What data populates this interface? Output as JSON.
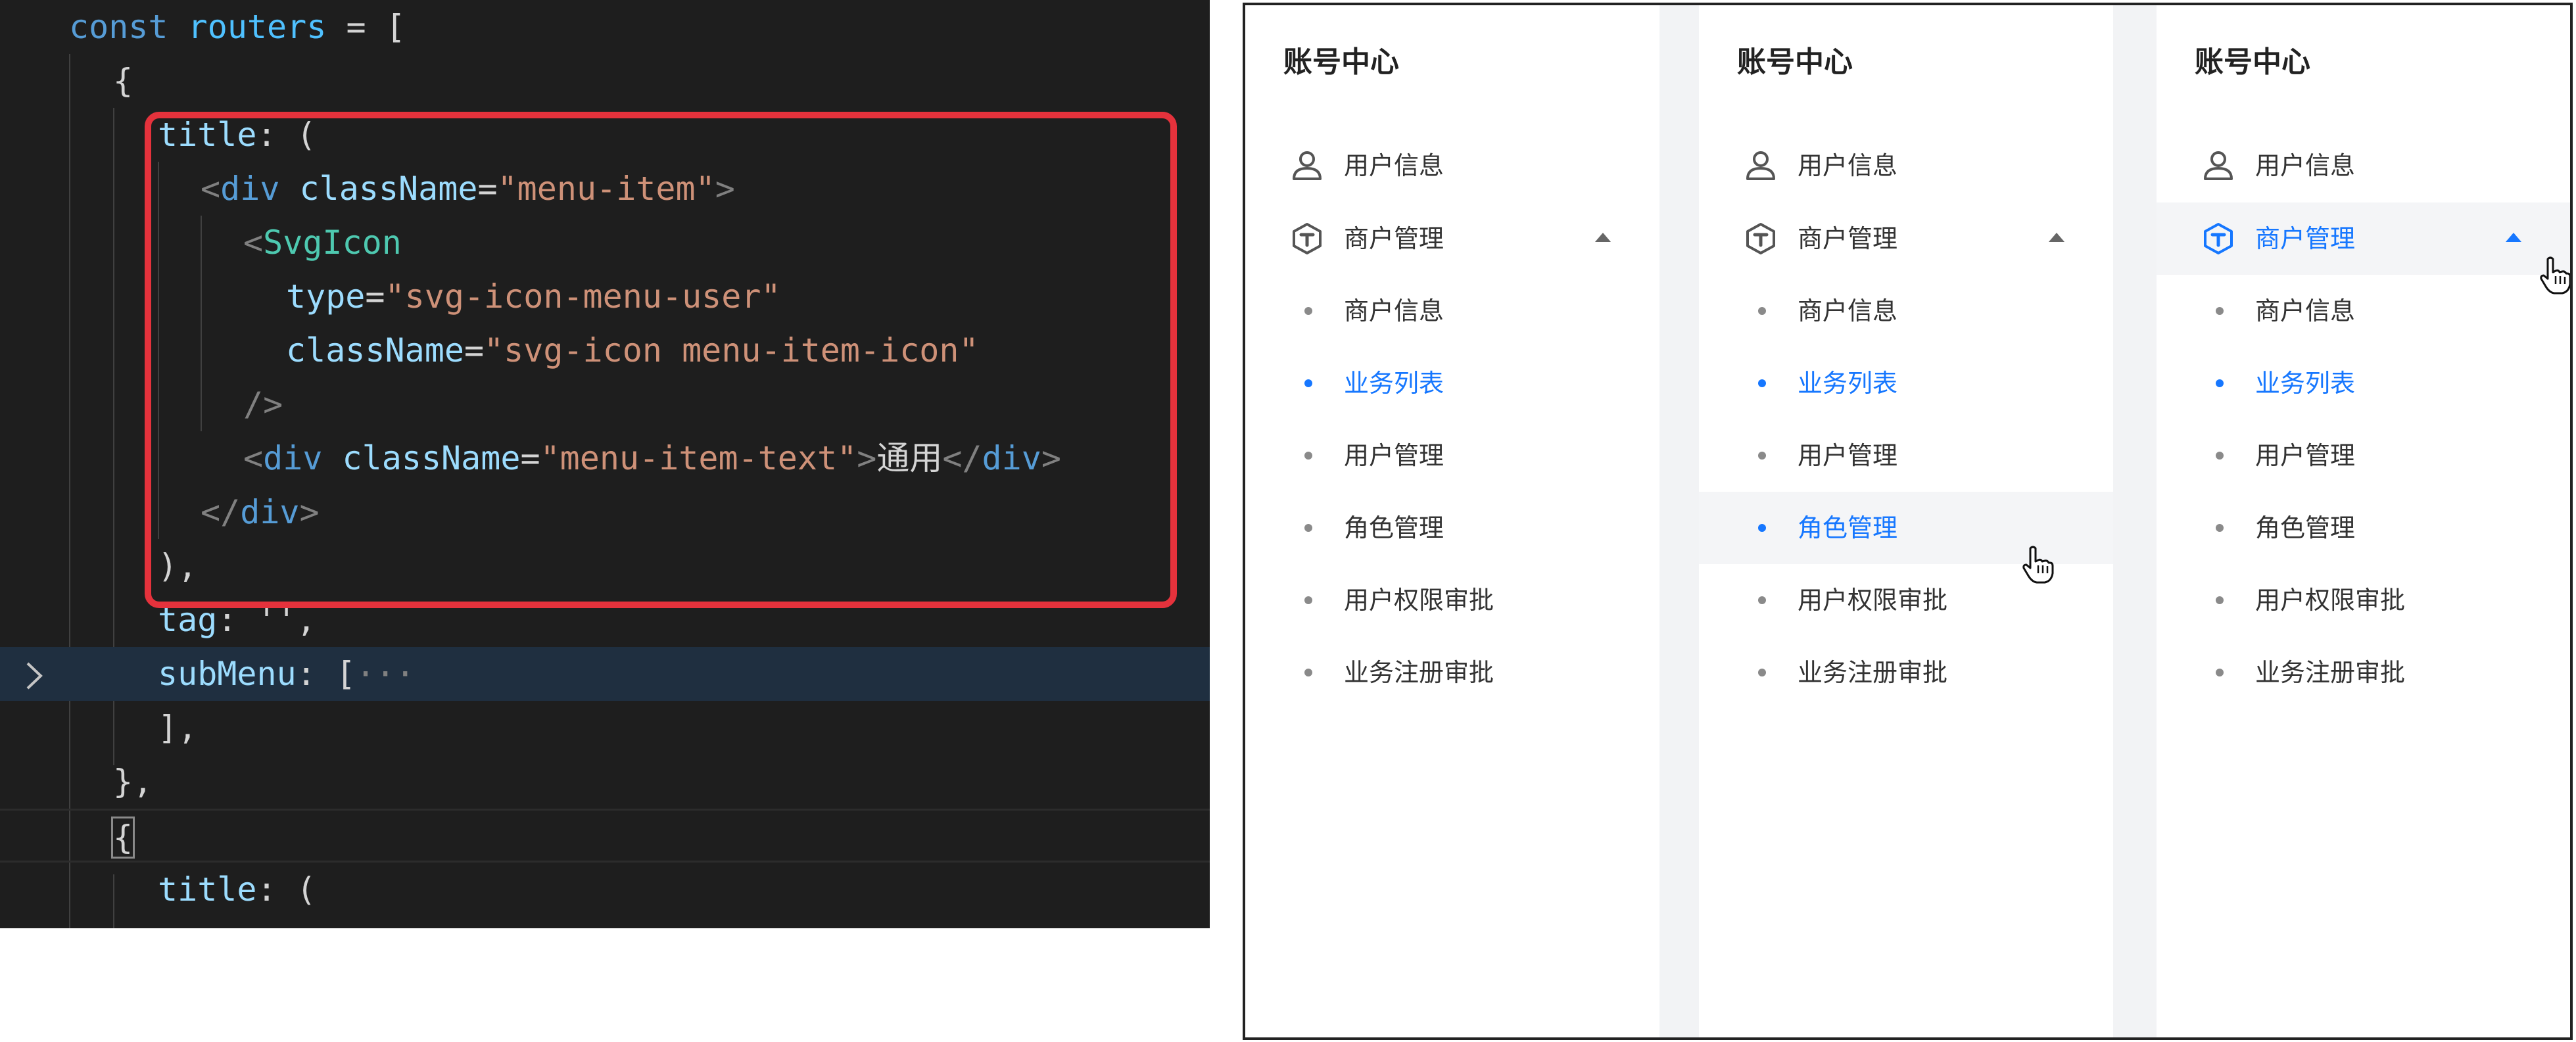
{
  "code": {
    "lines": [
      {
        "tokens": [
          {
            "t": "const ",
            "c": "kw"
          },
          {
            "t": "routers",
            "c": "var"
          },
          {
            "t": " = [",
            "c": "plain"
          }
        ]
      },
      {
        "tokens": [
          {
            "t": "{",
            "c": "plain"
          }
        ]
      },
      {
        "tokens": [
          {
            "t": "title",
            "c": "prop"
          },
          {
            "t": ": (",
            "c": "plain"
          }
        ]
      },
      {
        "tokens": [
          {
            "t": "<",
            "c": "punc"
          },
          {
            "t": "div",
            "c": "tag"
          },
          {
            "t": " ",
            "c": "plain"
          },
          {
            "t": "className",
            "c": "attr"
          },
          {
            "t": "=",
            "c": "plain"
          },
          {
            "t": "\"menu-item\"",
            "c": "str"
          },
          {
            "t": ">",
            "c": "punc"
          }
        ]
      },
      {
        "tokens": [
          {
            "t": "<",
            "c": "punc"
          },
          {
            "t": "SvgIcon",
            "c": "comp"
          }
        ]
      },
      {
        "tokens": [
          {
            "t": "type",
            "c": "attr"
          },
          {
            "t": "=",
            "c": "plain"
          },
          {
            "t": "\"svg-icon-menu-user\"",
            "c": "str"
          }
        ]
      },
      {
        "tokens": [
          {
            "t": "className",
            "c": "attr"
          },
          {
            "t": "=",
            "c": "plain"
          },
          {
            "t": "\"svg-icon menu-item-icon\"",
            "c": "str"
          }
        ]
      },
      {
        "tokens": [
          {
            "t": "/>",
            "c": "punc"
          }
        ]
      },
      {
        "tokens": [
          {
            "t": "<",
            "c": "punc"
          },
          {
            "t": "div",
            "c": "tag"
          },
          {
            "t": " ",
            "c": "plain"
          },
          {
            "t": "className",
            "c": "attr"
          },
          {
            "t": "=",
            "c": "plain"
          },
          {
            "t": "\"menu-item-text\"",
            "c": "str"
          },
          {
            "t": ">",
            "c": "punc"
          },
          {
            "t": "通用",
            "c": "plain"
          },
          {
            "t": "</",
            "c": "punc"
          },
          {
            "t": "div",
            "c": "tag"
          },
          {
            "t": ">",
            "c": "punc"
          }
        ]
      },
      {
        "tokens": [
          {
            "t": "</",
            "c": "punc"
          },
          {
            "t": "div",
            "c": "tag"
          },
          {
            "t": ">",
            "c": "punc"
          }
        ]
      },
      {
        "tokens": [
          {
            "t": "),",
            "c": "plain"
          }
        ]
      },
      {
        "tokens": [
          {
            "t": "tag",
            "c": "prop"
          },
          {
            "t": ": '',",
            "c": "plain"
          }
        ]
      },
      {
        "tokens": [
          {
            "t": "subMenu",
            "c": "prop"
          },
          {
            "t": ": [",
            "c": "plain"
          },
          {
            "t": "···",
            "c": "punc"
          }
        ]
      },
      {
        "tokens": [
          {
            "t": "],",
            "c": "plain"
          }
        ]
      },
      {
        "tokens": [
          {
            "t": "},",
            "c": "plain"
          }
        ]
      },
      {
        "tokens": [
          {
            "t": "{",
            "c": "bracket"
          }
        ]
      },
      {
        "tokens": [
          {
            "t": "title",
            "c": "prop"
          },
          {
            "t": ": (",
            "c": "plain"
          }
        ]
      }
    ]
  },
  "menus": [
    {
      "title": "账号中心",
      "items": [
        {
          "kind": "top",
          "icon": "user-icon",
          "label": "用户信息",
          "active": false,
          "hovered": false,
          "caret": false
        },
        {
          "kind": "top",
          "icon": "merchant-icon",
          "label": "商户管理",
          "active": false,
          "hovered": false,
          "caret": true
        },
        {
          "kind": "sub",
          "label": "商户信息",
          "active": false,
          "hovered": false
        },
        {
          "kind": "sub",
          "label": "业务列表",
          "active": true,
          "hovered": false
        },
        {
          "kind": "sub",
          "label": "用户管理",
          "active": false,
          "hovered": false
        },
        {
          "kind": "sub",
          "label": "角色管理",
          "active": false,
          "hovered": false
        },
        {
          "kind": "sub",
          "label": "用户权限审批",
          "active": false,
          "hovered": false
        },
        {
          "kind": "sub",
          "label": "业务注册审批",
          "active": false,
          "hovered": false
        }
      ],
      "cursor": null
    },
    {
      "title": "账号中心",
      "items": [
        {
          "kind": "top",
          "icon": "user-icon",
          "label": "用户信息",
          "active": false,
          "hovered": false,
          "caret": false
        },
        {
          "kind": "top",
          "icon": "merchant-icon",
          "label": "商户管理",
          "active": false,
          "hovered": false,
          "caret": true
        },
        {
          "kind": "sub",
          "label": "商户信息",
          "active": false,
          "hovered": false
        },
        {
          "kind": "sub",
          "label": "业务列表",
          "active": true,
          "hovered": false
        },
        {
          "kind": "sub",
          "label": "用户管理",
          "active": false,
          "hovered": false
        },
        {
          "kind": "sub",
          "label": "角色管理",
          "active": true,
          "hovered": true
        },
        {
          "kind": "sub",
          "label": "用户权限审批",
          "active": false,
          "hovered": false
        },
        {
          "kind": "sub",
          "label": "业务注册审批",
          "active": false,
          "hovered": false
        }
      ],
      "cursor": "pointer-hand-icon"
    },
    {
      "title": "账号中心",
      "items": [
        {
          "kind": "top",
          "icon": "user-icon",
          "label": "用户信息",
          "active": false,
          "hovered": false,
          "caret": false
        },
        {
          "kind": "top",
          "icon": "merchant-icon",
          "label": "商户管理",
          "active": true,
          "hovered": true,
          "caret": true
        },
        {
          "kind": "sub",
          "label": "商户信息",
          "active": false,
          "hovered": false
        },
        {
          "kind": "sub",
          "label": "业务列表",
          "active": true,
          "hovered": false
        },
        {
          "kind": "sub",
          "label": "用户管理",
          "active": false,
          "hovered": false
        },
        {
          "kind": "sub",
          "label": "角色管理",
          "active": false,
          "hovered": false
        },
        {
          "kind": "sub",
          "label": "用户权限审批",
          "active": false,
          "hovered": false
        },
        {
          "kind": "sub",
          "label": "业务注册审批",
          "active": false,
          "hovered": false
        }
      ],
      "cursor": "pointer-hand-icon"
    }
  ],
  "colors": {
    "accent": "#1677ff",
    "highlight_box": "#e5323c",
    "editor_bg": "#1e1e1e"
  }
}
